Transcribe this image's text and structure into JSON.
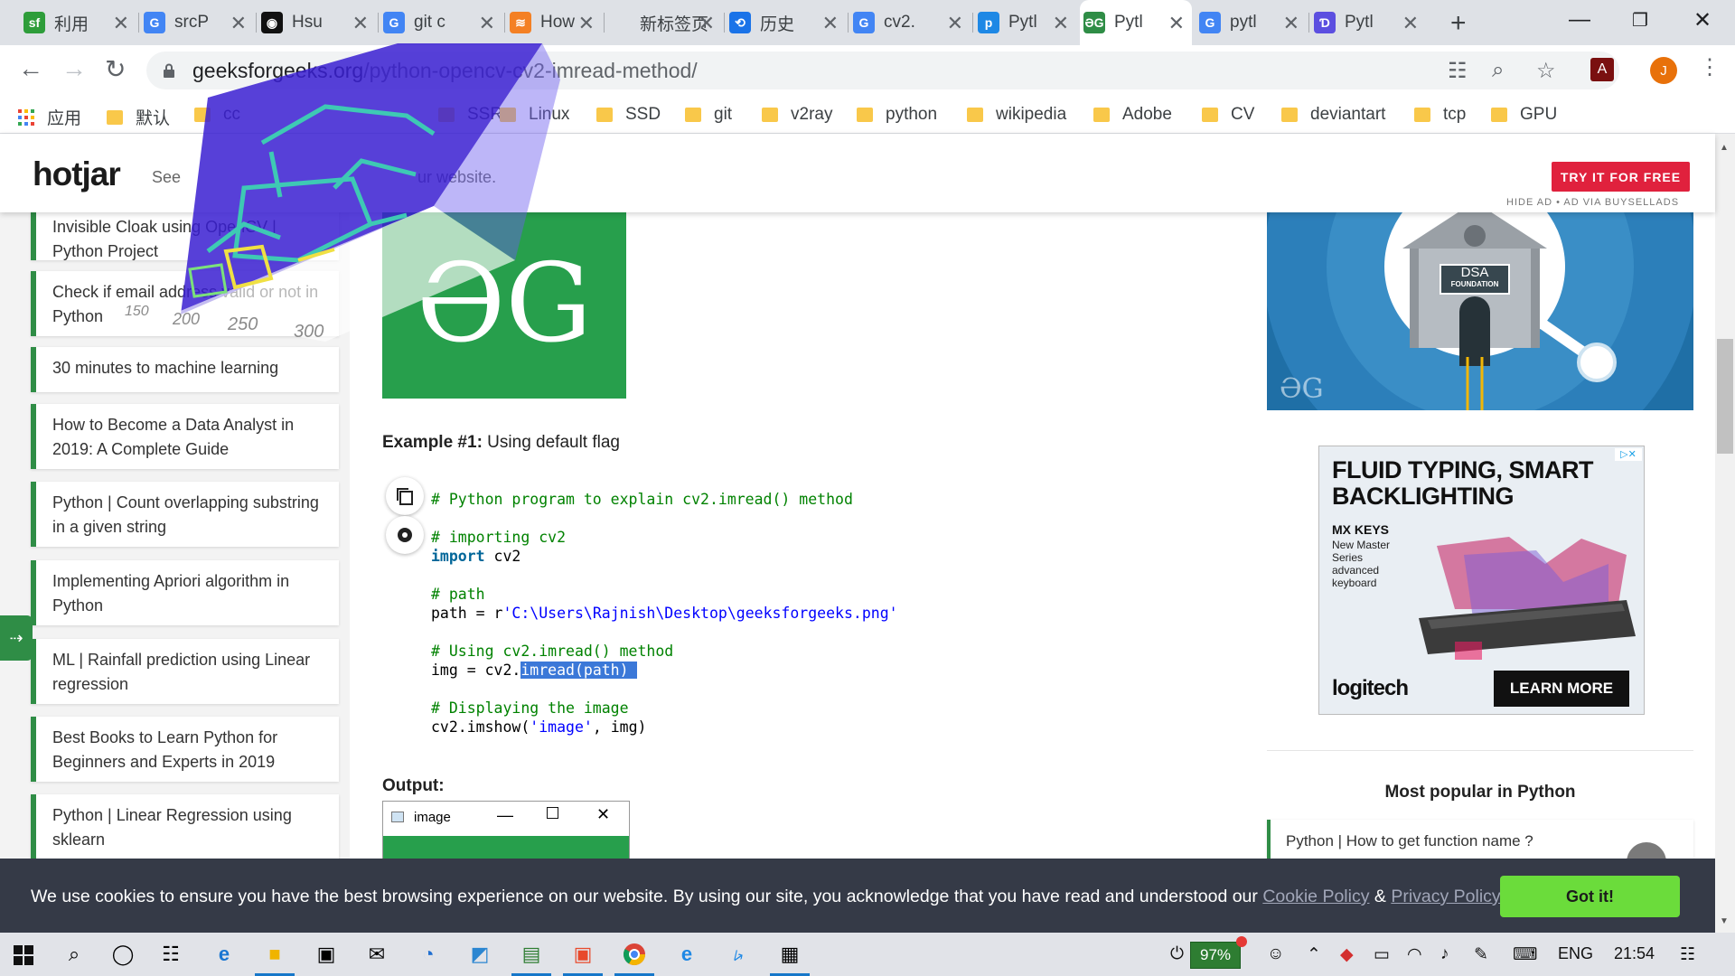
{
  "browser": {
    "tabs": [
      {
        "label": "利用",
        "fav_text": "sf",
        "fav_color": "#2e9d3a"
      },
      {
        "label": "srcP",
        "fav_text": "G",
        "fav_color": "#4285f4"
      },
      {
        "label": "Hsu",
        "fav_text": "◉",
        "fav_color": "#111111"
      },
      {
        "label": "git c",
        "fav_text": "G",
        "fav_color": "#4285f4"
      },
      {
        "label": "How",
        "fav_text": "≋",
        "fav_color": "#f48024"
      },
      {
        "label": "新标签页",
        "fav_text": "",
        "fav_color": "#dee1e6"
      },
      {
        "label": "历史",
        "fav_text": "⟲",
        "fav_color": "#1a73e8"
      },
      {
        "label": "cv2.",
        "fav_text": "G",
        "fav_color": "#4285f4"
      },
      {
        "label": "Pytl",
        "fav_text": "p",
        "fav_color": "#1e88e5"
      },
      {
        "label": "Pytl",
        "fav_text": "ƏG",
        "fav_color": "#2f8d46"
      },
      {
        "label": "pytl",
        "fav_text": "G",
        "fav_color": "#4285f4"
      },
      {
        "label": "Pytl",
        "fav_text": "Ɗ",
        "fav_color": "#5c4fe0"
      }
    ],
    "url_host": "geeksforgeeks.org",
    "url_path": "/python-opencv-cv2-imread-method/",
    "profile_initial": "J",
    "bookmarks": [
      "应用",
      "默认",
      "cc",
      "SSR",
      "Linux",
      "SSD",
      "git",
      "v2ray",
      "python",
      "wikipedia",
      "Adobe",
      "CV",
      "deviantart",
      "tcp",
      "GPU"
    ]
  },
  "ad": {
    "logo": "hotjar",
    "text": "See how visitors are really using your website.",
    "visible_text_start": "See",
    "visible_text_end": "ur website.",
    "button": "TRY IT FOR FREE",
    "note": "HIDE AD • AD VIA BUYSELLADS"
  },
  "sidebar": {
    "items": [
      "Invisible Cloak using OpenCV | Python Project",
      "Check if email address valid or not in Python",
      "30 minutes to machine learning",
      "How to Become a Data Analyst in 2019: A Complete Guide",
      "Python | Count overlapping substring in a given string",
      "Implementing Apriori algorithm in Python",
      "ML | Rainfall prediction using Linear regression",
      "Best Books to Learn Python for Beginners and Experts in 2019",
      "Python | Linear Regression using sklearn"
    ]
  },
  "article": {
    "logo_text": "ƏG",
    "example_bold": "Example #1:",
    "example_rest": " Using default flag",
    "code": {
      "c1": "# Python program to explain cv2.imread() method",
      "c2": "# importing cv2",
      "import_kw": "import",
      "import_mod": " cv2",
      "c3": "# path",
      "path_pre": "path = r",
      "path_str": "'C:\\Users\\Rajnish\\Desktop\\geeksforgeeks.png'",
      "c4": "# Using cv2.imread() method",
      "img_pre": "img = cv2.",
      "img_hl": "imread(path) ",
      "c5": "# Displaying the image",
      "show_pre": "cv2.imshow(",
      "show_str": "'image'",
      "show_post": ", img)"
    },
    "output_label": "Output:",
    "window_title": "image"
  },
  "overlay_ticks": [
    "150",
    "200",
    "250",
    "300"
  ],
  "right": {
    "dsa_badge_line1": "DSA",
    "dsa_badge_line2": "FOUNDATION",
    "dsa_logo": "ƏG",
    "logi_headline": "FLUID TYPING, SMART BACKLIGHTING",
    "logi_product": "MX KEYS",
    "logi_desc": "New Master Series advanced keyboard",
    "logi_brand": "logitech",
    "logi_cta": "LEARN MORE",
    "most_popular": "Most popular in Python",
    "popular_item": "Python | How to get function name ?"
  },
  "cookie": {
    "text": "We use cookies to ensure you have the best browsing experience on our website. By using our site, you acknowledge that you have read and understood our ",
    "cookie_policy": "Cookie Policy",
    "amp": " & ",
    "privacy_policy": "Privacy Policy",
    "button": "Got it!"
  },
  "taskbar": {
    "battery": "97%",
    "lang": "ENG",
    "time": "21:54"
  }
}
